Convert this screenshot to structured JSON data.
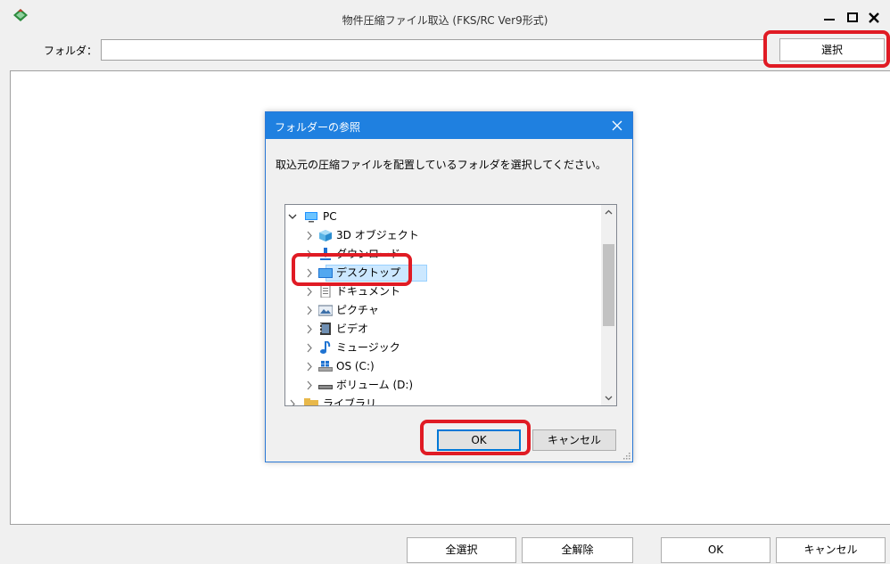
{
  "window": {
    "title": "物件圧縮ファイル取込 (FKS/RC Ver9形式)",
    "min_glyph": "—",
    "max_glyph": "☐",
    "close_glyph": "✕"
  },
  "folder": {
    "label": "フォルダ：",
    "value": "",
    "select_label": "選択"
  },
  "bottom_buttons": {
    "select_all": "全選択",
    "deselect_all": "全解除",
    "ok": "OK",
    "cancel": "キャンセル"
  },
  "dialog": {
    "title": "フォルダーの参照",
    "close_glyph": "✕",
    "instruction": "取込元の圧縮ファイルを配置しているフォルダを選択してください。",
    "ok": "OK",
    "cancel": "キャンセル",
    "tree": [
      {
        "label": "PC",
        "icon": "pc-icon",
        "expanded": true,
        "level": 0
      },
      {
        "label": "3D オブジェクト",
        "icon": "3d-objects-icon",
        "level": 1
      },
      {
        "label": "ダウンロード",
        "icon": "download-icon",
        "level": 1
      },
      {
        "label": "デスクトップ",
        "icon": "desktop-icon",
        "level": 1,
        "selected": true
      },
      {
        "label": "ドキュメント",
        "icon": "documents-icon",
        "level": 1
      },
      {
        "label": "ピクチャ",
        "icon": "pictures-icon",
        "level": 1
      },
      {
        "label": "ビデオ",
        "icon": "video-icon",
        "level": 1
      },
      {
        "label": "ミュージック",
        "icon": "music-icon",
        "level": 1
      },
      {
        "label": "OS (C:)",
        "icon": "drive-c-icon",
        "level": 1
      },
      {
        "label": "ボリューム (D:)",
        "icon": "drive-d-icon",
        "level": 1
      },
      {
        "label": "ライブラリ",
        "icon": "library-icon",
        "level": 0
      }
    ]
  },
  "colors": {
    "highlight": "#e01b24",
    "dialog_title": "#1f80e0",
    "selection": "#cce8ff"
  }
}
